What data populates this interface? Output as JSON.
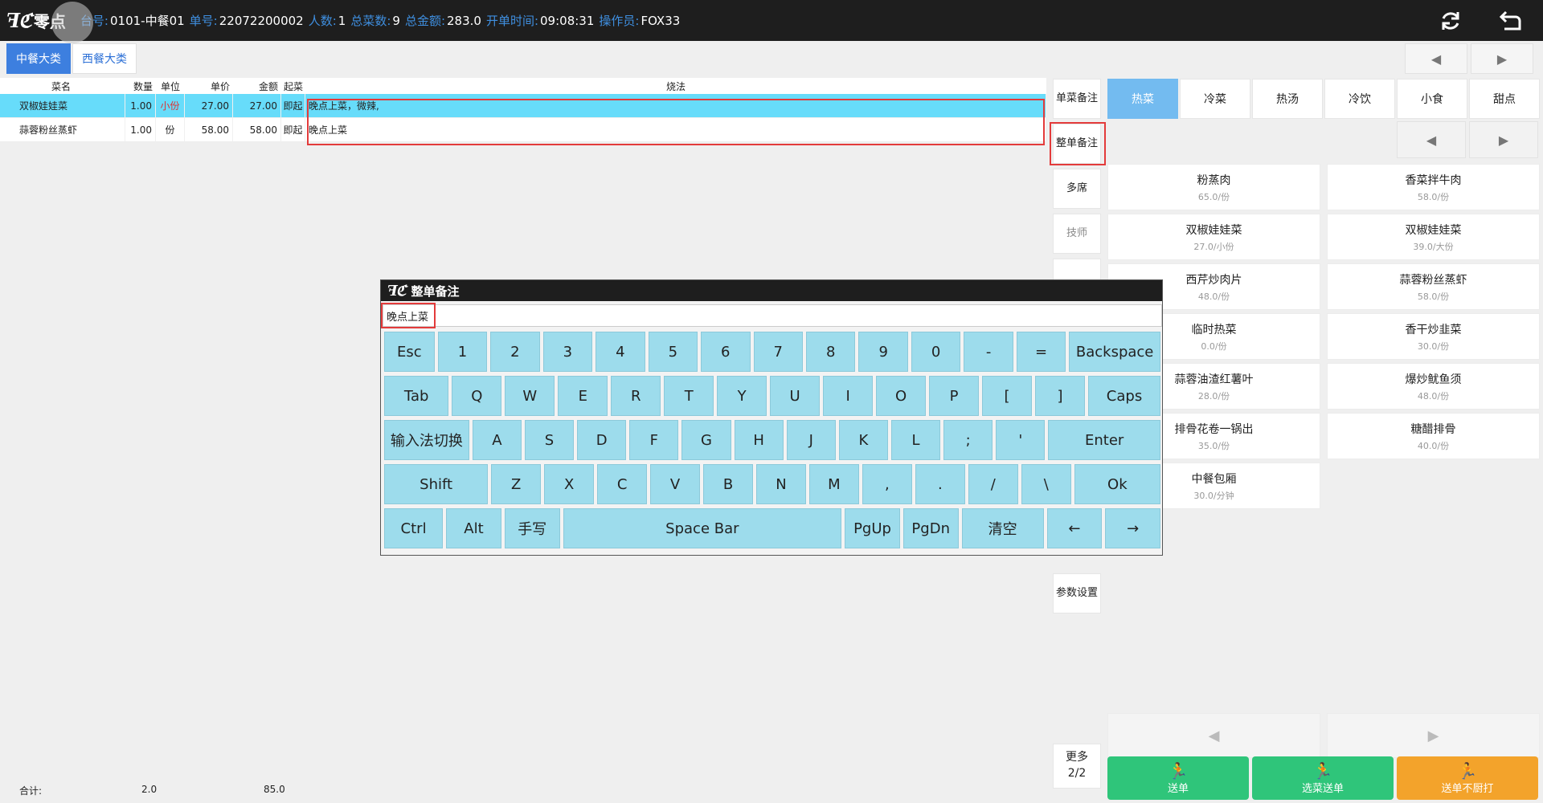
{
  "header": {
    "logo_text": "零点",
    "fields": [
      {
        "label": "台号:",
        "value": "0101-中餐01"
      },
      {
        "label": "单号:",
        "value": "22072200002"
      },
      {
        "label": "人数:",
        "value": "1"
      },
      {
        "label": "总菜数:",
        "value": "9"
      },
      {
        "label": "总金额:",
        "value": "283.0"
      },
      {
        "label": "开单时间:",
        "value": "09:08:31"
      },
      {
        "label": "操作员:",
        "value": "FOX33"
      }
    ],
    "icons": [
      "refresh-icon",
      "return-icon"
    ]
  },
  "categories": [
    {
      "label": "中餐大类",
      "active": true
    },
    {
      "label": "西餐大类",
      "active": false
    }
  ],
  "order": {
    "columns": [
      "菜名",
      "数量",
      "单位",
      "单价",
      "金额",
      "起菜",
      "烧法"
    ],
    "rows": [
      {
        "name": "双椒娃娃菜",
        "qty": "1.00",
        "unit": "小份",
        "price": "27.00",
        "amount": "27.00",
        "start": "即起",
        "method": "晚点上菜，微辣,",
        "selected": true
      },
      {
        "name": "蒜蓉粉丝蒸虾",
        "qty": "1.00",
        "unit": "份",
        "price": "58.00",
        "amount": "58.00",
        "start": "即起",
        "method": "晚点上菜",
        "selected": false
      }
    ],
    "totals": {
      "label": "合计:",
      "qty": "2.0",
      "amount": "85.0"
    }
  },
  "actions": {
    "single_note": "单菜备注",
    "whole_note": "整单备注",
    "multi_table": "多席",
    "technician": "技师",
    "param_settings": "参数设置",
    "more": "更多",
    "more_page": "2/2"
  },
  "sub_categories": [
    {
      "label": "热菜",
      "active": true
    },
    {
      "label": "冷菜",
      "active": false
    },
    {
      "label": "热汤",
      "active": false
    },
    {
      "label": "冷饮",
      "active": false
    },
    {
      "label": "小食",
      "active": false
    },
    {
      "label": "甜点",
      "active": false
    }
  ],
  "dishes": [
    {
      "name": "粉蒸肉",
      "price": "65.0/份"
    },
    {
      "name": "香菜拌牛肉",
      "price": "58.0/份"
    },
    {
      "name": "双椒娃娃菜",
      "price": "27.0/小份"
    },
    {
      "name": "双椒娃娃菜",
      "price": "39.0/大份"
    },
    {
      "name": "西芹炒肉片",
      "price": "48.0/份"
    },
    {
      "name": "蒜蓉粉丝蒸虾",
      "price": "58.0/份"
    },
    {
      "name": "临时热菜",
      "price": "0.0/份"
    },
    {
      "name": "香干炒韭菜",
      "price": "30.0/份"
    },
    {
      "name": "蒜蓉油渣红薯叶",
      "price": "28.0/份"
    },
    {
      "name": "爆炒鱿鱼须",
      "price": "48.0/份"
    },
    {
      "name": "排骨花卷一锅出",
      "price": "35.0/份"
    },
    {
      "name": "糖醋排骨",
      "price": "40.0/份"
    },
    {
      "name": "中餐包厢",
      "price": "30.0/分钟"
    }
  ],
  "bottom_actions": [
    {
      "label": "送单",
      "color": "#2fc57a"
    },
    {
      "label": "选菜送单",
      "color": "#2fc57a"
    },
    {
      "label": "送单不厨打",
      "color": "#f3a32b"
    }
  ],
  "modal": {
    "title": "整单备注",
    "input_value": "晚点上菜",
    "keyboard": [
      [
        "Esc",
        "1",
        "2",
        "3",
        "4",
        "5",
        "6",
        "7",
        "8",
        "9",
        "0",
        "-",
        "=",
        "Backspace"
      ],
      [
        "Tab",
        "Q",
        "W",
        "E",
        "R",
        "T",
        "Y",
        "U",
        "I",
        "O",
        "P",
        "[",
        "]",
        "Caps"
      ],
      [
        "输入法切换",
        "A",
        "S",
        "D",
        "F",
        "G",
        "H",
        "J",
        "K",
        "L",
        ";",
        "'",
        "Enter"
      ],
      [
        "Shift",
        "Z",
        "X",
        "C",
        "V",
        "B",
        "N",
        "M",
        ",",
        ".",
        "/",
        "\\",
        "Ok"
      ],
      [
        "Ctrl",
        "Alt",
        "手写",
        "Space Bar",
        "PgUp",
        "PgDn",
        "清空",
        "←",
        "→"
      ]
    ]
  },
  "colors": {
    "topbar": "#1e1e1e",
    "label_blue": "#3f8fe0",
    "selected_row": "#67dcfa",
    "key": "#9ddcec",
    "highlight": "#e33b3b"
  }
}
